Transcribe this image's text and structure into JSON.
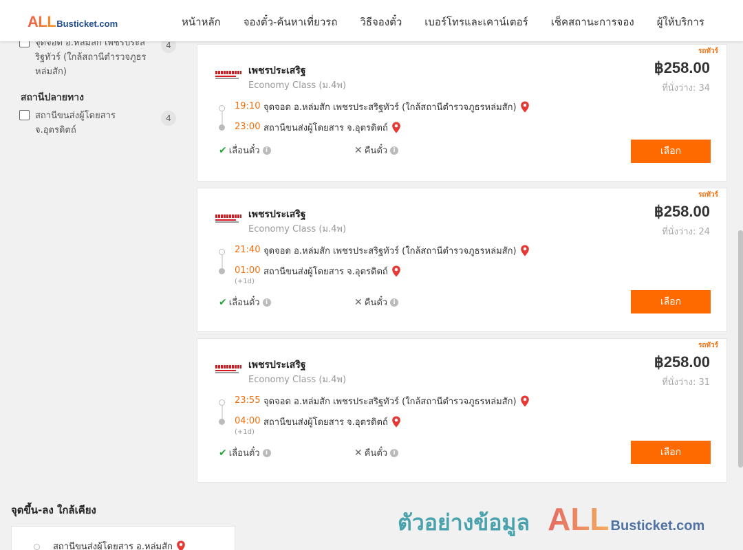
{
  "header": {
    "logo_all": "ALL",
    "logo_rest": "Busticket.com",
    "nav": [
      "หน้าหลัก",
      "จองตั๋ว-ค้นหาเที่ยวรถ",
      "วิธีจองตั๋ว",
      "เบอร์โทรและเคาน์เตอร์",
      "เช็คสถานะการจอง",
      "ผู้ให้บริการ"
    ]
  },
  "sidebar": {
    "origin_filters": [
      {
        "label": "จุดจอด อ.หล่มสัก เพชรประสริฐทัวร์ (ใกล้สถานีตำรวจภูธรหล่มสัก)",
        "count": "4"
      }
    ],
    "destination_title": "สถานีปลายทาง",
    "destination_filters": [
      {
        "label": "สถานีขนส่งผู้โดยสาร จ.อุตรดิตถ์",
        "count": "4"
      }
    ]
  },
  "cards": [
    {
      "badge": "รถทัวร์",
      "operator": "เพชรประเสริฐ",
      "bus_class": "Economy Class (ม.4พ)",
      "price": "฿258.00",
      "seats": "ที่นั่งว่าง: 34",
      "depart_time": "19:10",
      "depart_place": "จุดจอด อ.หล่มสัก เพชรประสริฐทัวร์ (ใกล้สถานีตำรวจภูธรหล่มสัก)",
      "arrive_time": "23:00",
      "arrive_place": "สถานีขนส่งผู้โดยสาร จ.อุตรดิตถ์",
      "next_day": "",
      "feature_change": "เลื่อนตั๋ว",
      "feature_refund": "คืนตั๋ว",
      "select_label": "เลือก"
    },
    {
      "badge": "รถทัวร์",
      "operator": "เพชรประเสริฐ",
      "bus_class": "Economy Class (ม.4พ)",
      "price": "฿258.00",
      "seats": "ที่นั่งว่าง: 24",
      "depart_time": "21:40",
      "depart_place": "จุดจอด อ.หล่มสัก เพชรประสริฐทัวร์ (ใกล้สถานีตำรวจภูธรหล่มสัก)",
      "arrive_time": "01:00",
      "arrive_place": "สถานีขนส่งผู้โดยสาร จ.อุตรดิตถ์",
      "next_day": "(+1d)",
      "feature_change": "เลื่อนตั๋ว",
      "feature_refund": "คืนตั๋ว",
      "select_label": "เลือก"
    },
    {
      "badge": "รถทัวร์",
      "operator": "เพชรประเสริฐ",
      "bus_class": "Economy Class (ม.4พ)",
      "price": "฿258.00",
      "seats": "ที่นั่งว่าง: 31",
      "depart_time": "23:55",
      "depart_place": "จุดจอด อ.หล่มสัก เพชรประสริฐทัวร์ (ใกล้สถานีตำรวจภูธรหล่มสัก)",
      "arrive_time": "04:00",
      "arrive_place": "สถานีขนส่งผู้โดยสาร จ.อุตรดิตถ์",
      "next_day": "(+1d)",
      "feature_change": "เลื่อนตั๋ว",
      "feature_refund": "คืนตั๋ว",
      "select_label": "เลือก"
    }
  ],
  "nearby": {
    "title": "จุดขึ้น-ลง ใกล้เคียง",
    "places": [
      "สถานีขนส่งผู้โดยสาร อ.หล่มสัก"
    ]
  },
  "watermark": {
    "text": "ตัวอย่างข้อมูล",
    "logo_all": "ALL",
    "logo_rest": "Busticket.com"
  },
  "colors": {
    "accent": "#ff6a00",
    "time": "#f46e0a",
    "check": "#22a63b",
    "pin": "#e53935",
    "logo_blue": "#1f4d8c"
  },
  "icons": {
    "location": "map-pin-icon",
    "check": "check-icon",
    "cross": "x-icon",
    "info": "info-icon"
  }
}
